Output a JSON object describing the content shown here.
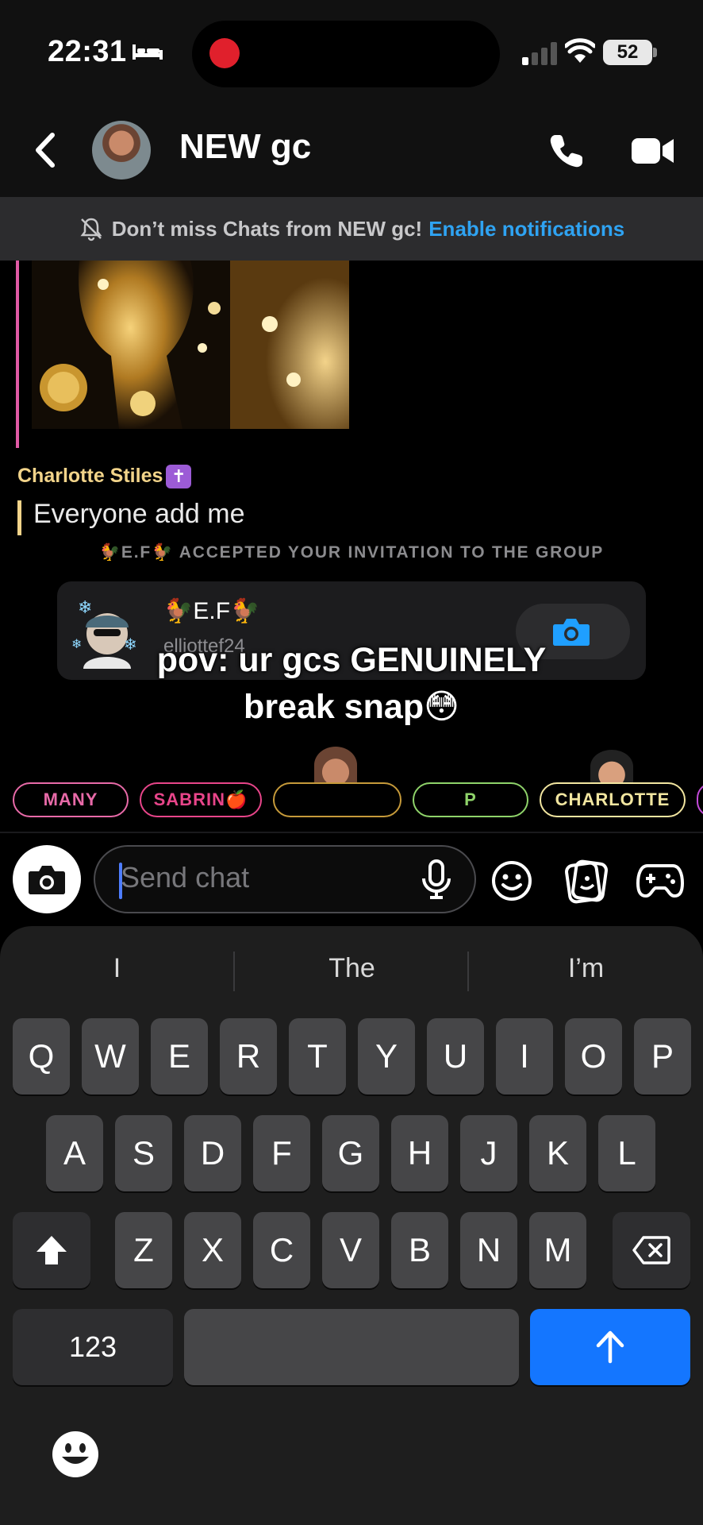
{
  "status_bar": {
    "time": "22:31",
    "battery": "52"
  },
  "header": {
    "title": "NEW gc"
  },
  "banner": {
    "text": "Don’t miss Chats from NEW gc!",
    "link": "Enable notifications"
  },
  "chat": {
    "sender": "Charlotte Stiles",
    "sender_badge": "✝",
    "message": "Everyone add me",
    "system_message": "🐓E.F🐓 ACCEPTED YOUR INVITATION TO THE GROUP",
    "card": {
      "name": "🐓E.F🐓",
      "username": "elliottef24"
    }
  },
  "caption": {
    "line1": "pov: ur gcs GENUINELY",
    "line2": "break snap😳"
  },
  "friends": [
    {
      "name": "MANY",
      "color": "#e86aa8"
    },
    {
      "name": "SABRIN🍎",
      "color": "#e8458a"
    },
    {
      "name": "",
      "color": "#c69a3a"
    },
    {
      "name": "P",
      "color": "#8fd36a"
    },
    {
      "name": "CHARLOTTE",
      "color": "#f2e6a0"
    }
  ],
  "composer": {
    "placeholder": "Send chat"
  },
  "keyboard": {
    "suggestions": [
      "I",
      "The",
      "I’m"
    ],
    "row1": [
      "Q",
      "W",
      "E",
      "R",
      "T",
      "Y",
      "U",
      "I",
      "O",
      "P"
    ],
    "row2": [
      "A",
      "S",
      "D",
      "F",
      "G",
      "H",
      "J",
      "K",
      "L"
    ],
    "row3": [
      "Z",
      "X",
      "C",
      "V",
      "B",
      "N",
      "M"
    ],
    "numbers_key": "123"
  },
  "icons": {
    "back": "chevron-left-icon",
    "call": "phone-icon",
    "video": "video-icon",
    "camera": "camera-icon",
    "mic": "microphone-icon",
    "emoji": "smiley-icon",
    "sticker": "sticker-icon",
    "games": "gamepad-icon"
  }
}
